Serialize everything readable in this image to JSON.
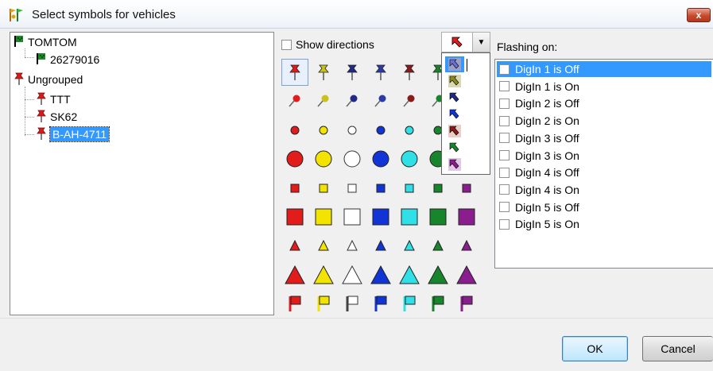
{
  "window": {
    "title": "Select symbols for vehicles",
    "close_label": "x"
  },
  "tree": {
    "nodes": [
      {
        "label": "TOMTOM",
        "icon": "green-flag-icon",
        "level": 0
      },
      {
        "label": "26279016",
        "icon": "green-flag-icon",
        "level": 1
      },
      {
        "label": "Ungrouped",
        "icon": "red-pushpin-icon",
        "level": 0
      },
      {
        "label": "TTT",
        "icon": "red-pushpin-icon",
        "level": 1
      },
      {
        "label": "SK62",
        "icon": "red-pushpin-icon",
        "level": 1
      },
      {
        "label": "B-AH-4711",
        "icon": "red-pushpin-icon",
        "level": 1,
        "selected": true
      }
    ]
  },
  "symbols": {
    "show_directions_label": "Show directions",
    "show_directions_checked": false,
    "colors": [
      "#e21b1b",
      "#f2e400",
      "#ffffff",
      "#1034d6",
      "#2fe0e6",
      "#17852b",
      "#8a1e8e"
    ],
    "pin_colors": [
      "#e21b1b",
      "#c9c21a",
      "#1e2a86",
      "#2a3aa8",
      "#8b1a1a",
      "#17852b",
      "#8a1e8e"
    ],
    "rows": [
      "pushpin",
      "needle-pin",
      "small-circle",
      "large-circle",
      "small-square",
      "large-square",
      "small-triangle",
      "large-triangle",
      "flag"
    ],
    "selected": {
      "row": "pushpin",
      "column": 0
    }
  },
  "direction_dropdown": {
    "selected_color": "#e21b1b",
    "items": [
      {
        "arrow": "#6b6fd6",
        "bg": "#9aa0c8",
        "highlighted": true
      },
      {
        "arrow": "#8a8a1a",
        "bg": "#d9d8b0"
      },
      {
        "arrow": "#1e2a86",
        "bg": "#ffffff"
      },
      {
        "arrow": "#1034d6",
        "bg": "#ffffff"
      },
      {
        "arrow": "#8b1a1a",
        "bg": "#e6d0c8"
      },
      {
        "arrow": "#17852b",
        "bg": "#ffffff"
      },
      {
        "arrow": "#8a1e8e",
        "bg": "#e2c8e6"
      }
    ]
  },
  "flashing": {
    "label": "Flashing on:",
    "items": [
      {
        "label": "DigIn 1 is Off",
        "checked": false,
        "highlighted": true
      },
      {
        "label": "DigIn 1 is On",
        "checked": false
      },
      {
        "label": "DigIn 2 is Off",
        "checked": false
      },
      {
        "label": "DigIn 2 is On",
        "checked": false
      },
      {
        "label": "DigIn 3 is Off",
        "checked": false
      },
      {
        "label": "DigIn 3 is On",
        "checked": false
      },
      {
        "label": "DigIn 4 is Off",
        "checked": false
      },
      {
        "label": "DigIn 4 is On",
        "checked": false
      },
      {
        "label": "DigIn 5 is Off",
        "checked": false
      },
      {
        "label": "DigIn 5 is On",
        "checked": false
      }
    ]
  },
  "buttons": {
    "ok_label": "OK",
    "cancel_label": "Cancel"
  }
}
